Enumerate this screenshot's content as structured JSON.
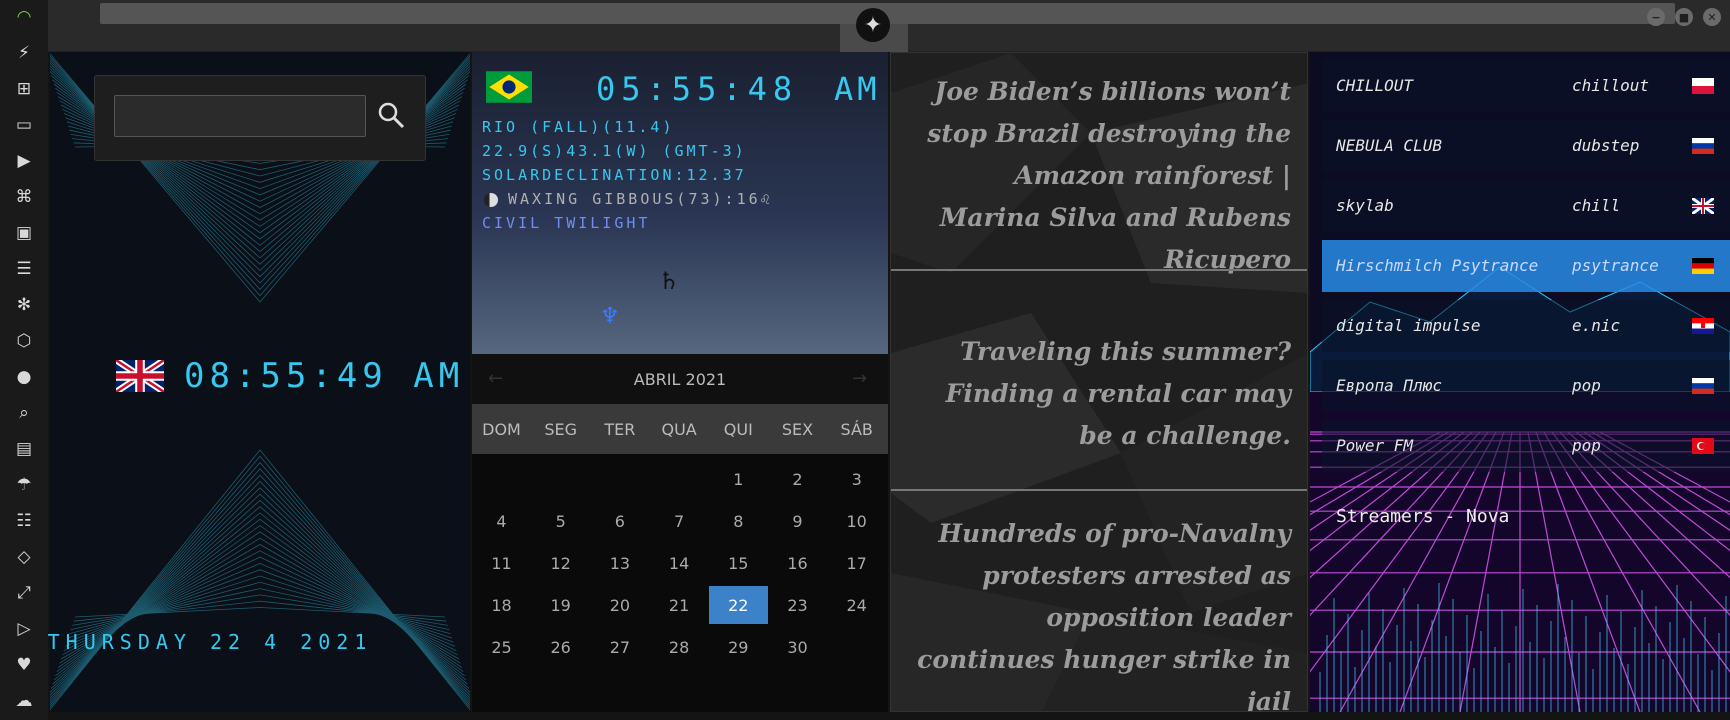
{
  "rail": {
    "icons": [
      "wifi-icon",
      "flash-icon",
      "windows-icon",
      "archive-icon",
      "play-icon",
      "map-book-icon",
      "image-icon",
      "news-icon",
      "snowflake-icon",
      "hexagon-icon",
      "globe-icon",
      "search-icon",
      "map-icon",
      "umbrella-icon",
      "contacts-icon",
      "code-icon",
      "fullscreen-icon",
      "youtube-icon",
      "heart-icon",
      "cloud-icon"
    ]
  },
  "window": {
    "minimize_glyph": "−",
    "maximize_glyph": "■",
    "close_glyph": "✕",
    "emblem_glyph": "✦"
  },
  "uk_clock": {
    "search": {
      "value": "",
      "placeholder": ""
    },
    "time": "08:55:49 AM",
    "date": "THURSDAY 22 4 2021"
  },
  "brazil": {
    "time": "05:55:48",
    "ampm": "AM",
    "lines": [
      "RIO (FALL)(11.4)",
      "22.9(S)43.1(W) (GMT-3)",
      "SOLARDECLINATION:12.37",
      "WAXING GIBBOUS(73):16♌",
      "CIVIL TWILIGHT"
    ],
    "saturn": "♄",
    "neptune": "♆"
  },
  "calendar": {
    "prev": "←",
    "next": "→",
    "month": "ABRIL 2021",
    "weekdays": [
      "DOM",
      "SEG",
      "TER",
      "QUA",
      "QUI",
      "SEX",
      "SÁB"
    ],
    "days": [
      1,
      2,
      3,
      4,
      5,
      6,
      7,
      8,
      9,
      10,
      11,
      12,
      13,
      14,
      15,
      16,
      17,
      18,
      19,
      20,
      21,
      22,
      23,
      24,
      25,
      26,
      27,
      28,
      29,
      30
    ],
    "first_weekday": 4,
    "today": 22
  },
  "news": {
    "items": [
      "Joe Biden’s billions won’t stop Brazil destroying the Amazon rainforest | Marina Silva and Rubens Ricupero",
      "Traveling this summer? Finding a rental car may be a challenge.",
      "Hundreds of pro-Navalny protesters arrested as opposition leader continues hunger strike in jail"
    ]
  },
  "radio": {
    "stations": [
      {
        "name": "CHILLOUT",
        "genre": "chillout",
        "flag": "poland"
      },
      {
        "name": "NEBULA CLUB",
        "genre": "dubstep",
        "flag": "russia"
      },
      {
        "name": "skylab",
        "genre": "chill",
        "flag": "uk"
      },
      {
        "name": "Hirschmilch Psytrance",
        "genre": "psytrance",
        "flag": "germany",
        "active": true
      },
      {
        "name": "digital impulse",
        "genre": "e.nic",
        "flag": "croatia"
      },
      {
        "name": "Европа Плюс",
        "genre": "pop",
        "flag": "russia"
      },
      {
        "name": "Power FM",
        "genre": "pop",
        "flag": "turkey"
      }
    ],
    "title": "Streamers - Nova"
  },
  "colors": {
    "accent_cyan": "#37c8f0",
    "active_station": "#288ce6",
    "wifi_green": "#6fcf3a"
  }
}
